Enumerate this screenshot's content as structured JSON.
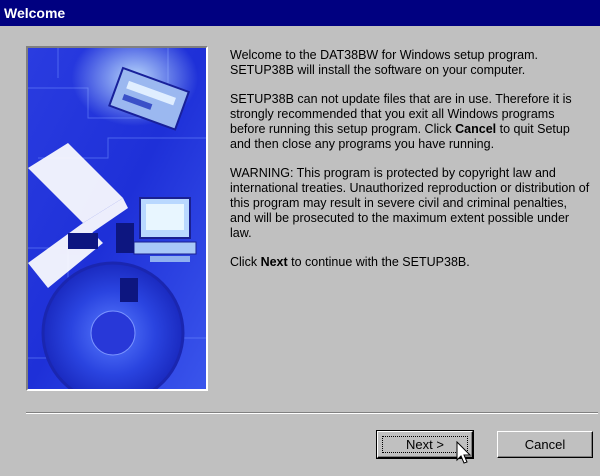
{
  "window": {
    "title": "Welcome"
  },
  "content": {
    "para1": "Welcome to the DAT38BW for Windows setup program. SETUP38B will install the software on your computer.",
    "para2_a": "SETUP38B can not update files that are in use.  Therefore it is strongly recommended that you exit all Windows programs before running this setup program.  Click ",
    "para2_bold": "Cancel",
    "para2_b": " to quit Setup and then close any programs you have running.",
    "para3": "WARNING:  This program is protected by copyright law and international treaties.  Unauthorized reproduction or distribution of this program may result in severe civil and criminal penalties, and will be prosecuted to the maximum extent possible under law.",
    "para4_a": "Click ",
    "para4_bold": "Next",
    "para4_b": " to continue with the SETUP38B."
  },
  "buttons": {
    "next_label": "Next >",
    "cancel_label": "Cancel"
  },
  "colors": {
    "titlebar": "#000080",
    "face": "#c0c0c0",
    "image_base": "#1d2ad0"
  },
  "icons": {
    "side_image": "setup-computer-banner-image",
    "cursor": "mouse-pointer-icon"
  }
}
